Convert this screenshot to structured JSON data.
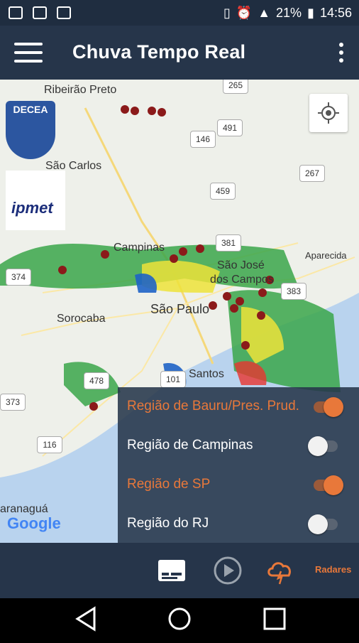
{
  "status_bar": {
    "icons": [
      "image-icon",
      "signal-off-icon",
      "briefcase-icon"
    ],
    "battery_percent": "21%",
    "time": "14:56"
  },
  "app_bar": {
    "title": "Chuva Tempo Real",
    "menu_icon": "hamburger-menu-icon",
    "overflow_icon": "more-vert-icon"
  },
  "map": {
    "cities": [
      "Ribeirão Preto",
      "São Carlos",
      "Campinas",
      "São José dos Campos",
      "Aparecida",
      "Sorocaba",
      "São Paulo",
      "Santos",
      "Paranaguá"
    ],
    "city_lines": {
      "sjc_1": "São José",
      "sjc_2": "dos Campos",
      "paranagua_visible": "aranaguá"
    },
    "road_shields": [
      "265",
      "146",
      "491",
      "459",
      "267",
      "381",
      "374",
      "383",
      "478",
      "101",
      "373",
      "116"
    ],
    "logos": {
      "decea": "DECEA",
      "ipmet": "ipmet",
      "google": "Google"
    },
    "locate_icon": "my-location-icon"
  },
  "regions_panel": {
    "items": [
      {
        "label": "Região de Bauru/Pres. Prud.",
        "enabled": true
      },
      {
        "label": "Região de Campinas",
        "enabled": false
      },
      {
        "label": "Região de SP",
        "enabled": true
      },
      {
        "label": "Região do RJ",
        "enabled": false
      }
    ]
  },
  "bottom_bar": {
    "radares_label": "Radares",
    "icons": [
      "subtitles-icon",
      "play-icon",
      "radar-cloud-icon"
    ]
  },
  "colors": {
    "accent": "#e8783a",
    "appbar": "#26354a",
    "statusbar": "#1f2d40"
  },
  "nav_bar": {
    "icons": [
      "back-icon",
      "home-icon",
      "recents-icon"
    ]
  }
}
